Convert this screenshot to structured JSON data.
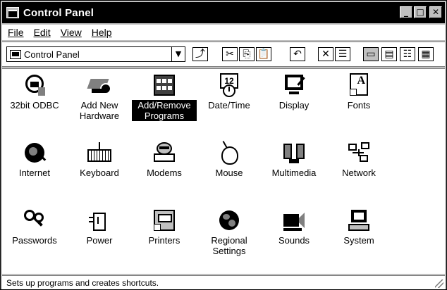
{
  "window": {
    "title": "Control Panel"
  },
  "title_buttons": {
    "minimize": "_",
    "maximize": "□",
    "close": "✕"
  },
  "menu": {
    "file": "File",
    "edit": "Edit",
    "view": "View",
    "help": "Help"
  },
  "address": {
    "value": "Control Panel",
    "dropdown": "▼"
  },
  "toolbar": {
    "up": "⤴",
    "cut": "✂",
    "copy": "⎘",
    "paste": "📋",
    "undo": "↶",
    "delete": "✕",
    "properties": "☰",
    "large_icons": "▭",
    "small_icons": "▤",
    "list": "☷",
    "details": "▦"
  },
  "items": [
    {
      "label": "32bit ODBC",
      "icon": "odbc-icon"
    },
    {
      "label": "Add New Hardware",
      "icon": "add-hardware-icon"
    },
    {
      "label": "Add/Remove Programs",
      "icon": "add-remove-programs-icon"
    },
    {
      "label": "Date/Time",
      "icon": "date-time-icon"
    },
    {
      "label": "Display",
      "icon": "display-icon"
    },
    {
      "label": "Fonts",
      "icon": "fonts-icon"
    },
    {
      "label": "Internet",
      "icon": "internet-icon"
    },
    {
      "label": "Keyboard",
      "icon": "keyboard-icon"
    },
    {
      "label": "Modems",
      "icon": "modems-icon"
    },
    {
      "label": "Mouse",
      "icon": "mouse-icon"
    },
    {
      "label": "Multimedia",
      "icon": "multimedia-icon"
    },
    {
      "label": "Network",
      "icon": "network-icon"
    },
    {
      "label": "Passwords",
      "icon": "passwords-icon"
    },
    {
      "label": "Power",
      "icon": "power-icon"
    },
    {
      "label": "Printers",
      "icon": "printers-icon"
    },
    {
      "label": "Regional Settings",
      "icon": "regional-settings-icon"
    },
    {
      "label": "Sounds",
      "icon": "sounds-icon"
    },
    {
      "label": "System",
      "icon": "system-icon"
    }
  ],
  "datetime_icon_text": "12",
  "fonts_icon_text": "A",
  "status": {
    "text": "Sets up programs and creates shortcuts."
  }
}
